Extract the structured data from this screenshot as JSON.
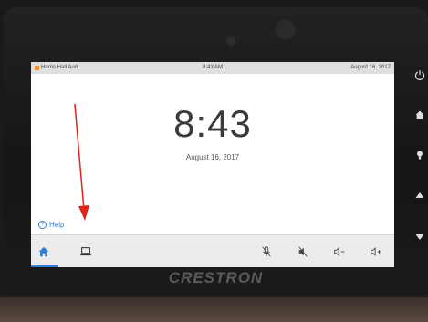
{
  "status_bar": {
    "room_name": "Harris Hall Aud",
    "time": "8:43 AM",
    "date": "August 16, 2017"
  },
  "main": {
    "clock": "8:43",
    "date": "August 16, 2017",
    "help_label": "Help"
  },
  "nav": {
    "items": [
      {
        "name": "home",
        "icon": "home-icon",
        "selected": true
      },
      {
        "name": "laptop",
        "icon": "laptop-icon"
      },
      {
        "name": "mic-mute",
        "icon": "mic-off-icon"
      },
      {
        "name": "speaker-mute",
        "icon": "speaker-mute-icon"
      },
      {
        "name": "volume-down",
        "icon": "volume-down-icon"
      },
      {
        "name": "volume-up",
        "icon": "volume-up-icon"
      }
    ]
  },
  "device": {
    "brand": "CRESTRON",
    "hardware_buttons": [
      "power-icon",
      "home-icon",
      "light-icon",
      "up-icon",
      "down-icon"
    ]
  },
  "colors": {
    "accent": "#2f7fd3",
    "room_dot": "#f08a1c",
    "annotation": "#e0231c"
  }
}
